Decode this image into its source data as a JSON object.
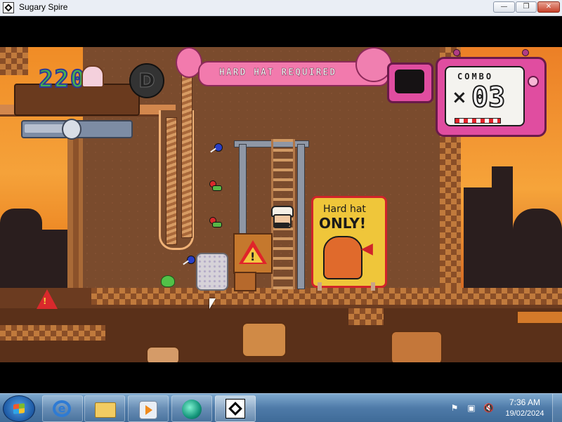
{
  "window": {
    "title": "Sugary Spire",
    "buttons": {
      "minimize": "—",
      "maximize": "❐",
      "close": "✕"
    }
  },
  "hud": {
    "score": "220",
    "rank": "D",
    "heat_meter_level": 0.45
  },
  "banner": {
    "text": "HARD HAT REQUIRED"
  },
  "combo": {
    "label": "COMBO",
    "multiplier_symbol": "×",
    "count": "03"
  },
  "sign": {
    "line1": "Hard hat",
    "line2": "ONLY!",
    "arrow": "◀"
  },
  "warning_block": {
    "mark": "!"
  },
  "cone": {
    "mark": "!"
  },
  "taskbar": {
    "pinned": [
      {
        "name": "internet-explorer",
        "icon": "ie-icon"
      },
      {
        "name": "windows-explorer",
        "icon": "folder-icon"
      },
      {
        "name": "media-player",
        "icon": "media-player-icon"
      },
      {
        "name": "app",
        "icon": "app-icon"
      },
      {
        "name": "sugary-spire",
        "icon": "sugary-spire-icon",
        "active": true
      }
    ],
    "tray": {
      "flag": "⚑",
      "network": "▣",
      "volume": "🔇"
    },
    "clock": {
      "time": "7:36 AM",
      "date": "19/02/2024"
    }
  },
  "colors": {
    "banner_pink": "#f27aad",
    "tv_magenta": "#e04da0",
    "sign_yellow": "#efc63a",
    "sign_red": "#d0242a",
    "score_green": "#46b14f"
  }
}
